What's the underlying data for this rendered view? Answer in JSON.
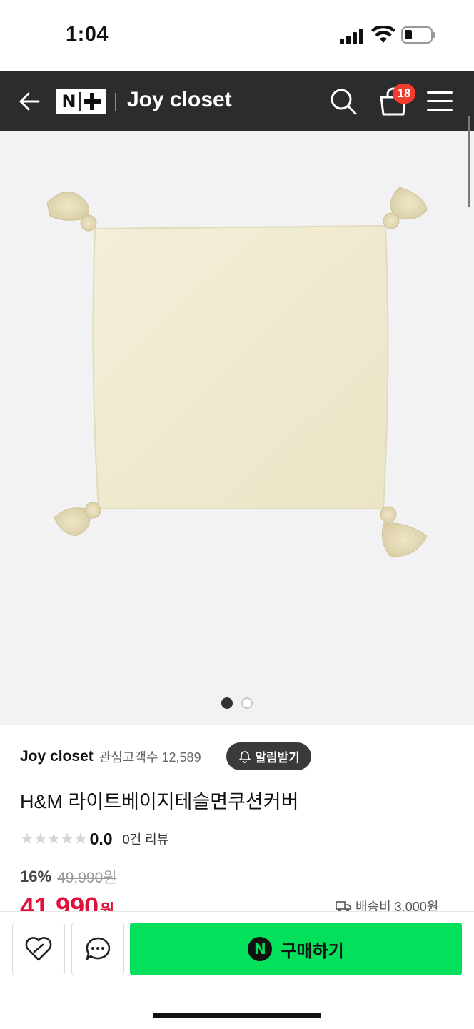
{
  "status_bar": {
    "time": "1:04"
  },
  "header": {
    "logo_text": "N",
    "store_name": "Joy closet",
    "cart_count": "18",
    "icons": [
      "back-arrow-icon",
      "search-icon",
      "shopping-bag-icon",
      "hamburger-menu-icon"
    ],
    "background_color": "#2b2c2d"
  },
  "gallery": {
    "image_description_icon": "product-photo",
    "active_index": 1,
    "total": 2
  },
  "store": {
    "name": "Joy closet",
    "followers_label": "관심고객수 12,589",
    "alarm_label": "알림받기"
  },
  "product": {
    "title": "H&M 라이트베이지테슬면쿠션커버",
    "rating": "0.0",
    "review_count": "0건 리뷰",
    "discount": "16%",
    "original_price": "49,990원",
    "sale_price": "41,990",
    "sale_unit": "원",
    "shipping": "배송비 3,000원",
    "sale_color": "#e0103a"
  },
  "bottom_bar": {
    "buy_logo": "N",
    "buy_label": "구매하기",
    "buy_color": "#03e05c"
  }
}
